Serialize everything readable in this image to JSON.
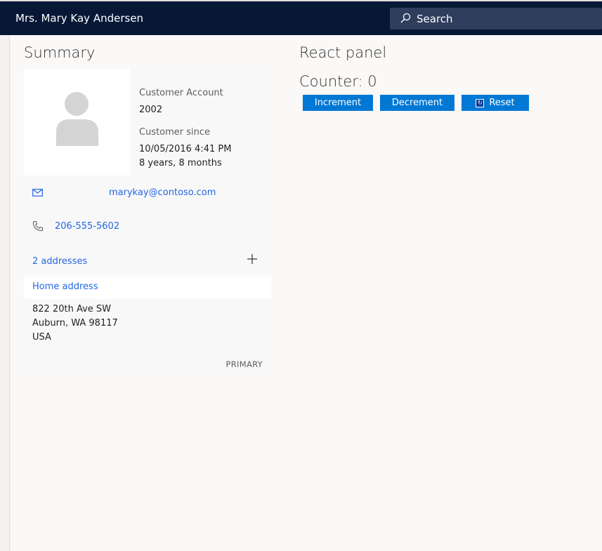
{
  "header": {
    "customer_name": "Mrs. Mary Kay Andersen",
    "search_placeholder": "Search",
    "bg_color": "#071837"
  },
  "summary": {
    "title": "Summary",
    "customer_account_label": "Customer Account",
    "customer_account_value": "2002",
    "customer_since_label": "Customer since",
    "customer_since_date": "10/05/2016 4:41 PM",
    "customer_since_duration": "8 years, 8 months",
    "email": "marykay@contoso.com",
    "phone": "206-555-5602",
    "addresses_link": "2 addresses",
    "home_address_label": "Home address",
    "address_lines": [
      "822 20th Ave SW",
      "Auburn, WA 98117",
      "USA"
    ],
    "primary_badge": "PRIMARY",
    "link_color": "#2266e3",
    "icons": [
      "mail-icon",
      "phone-icon",
      "plus-icon",
      "person-avatar-icon"
    ]
  },
  "react_panel": {
    "title": "React panel",
    "counter_text": "Counter: 0",
    "buttons": {
      "increment": "Increment",
      "decrement": "Decrement",
      "reset": "Reset"
    },
    "button_color": "#0078d4"
  }
}
